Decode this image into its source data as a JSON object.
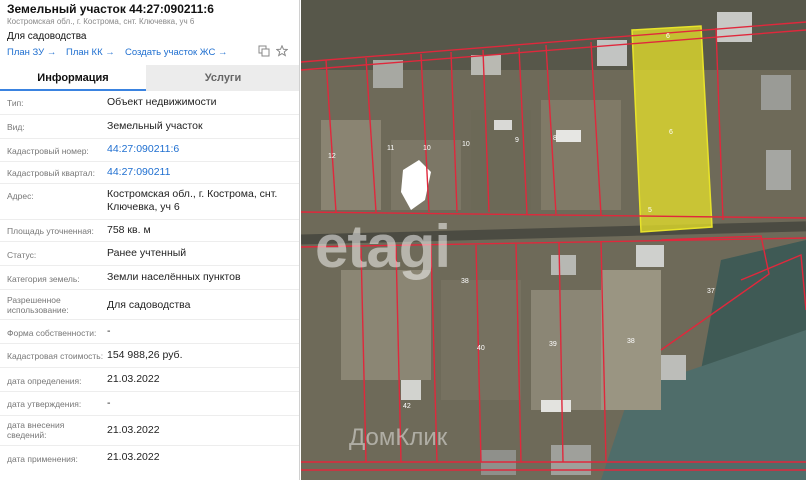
{
  "header": {
    "title": "Земельный участок 44:27:090211:6",
    "address": "Костромская обл., г. Кострома, снт. Ключевка, уч 6",
    "usage": "Для садоводства"
  },
  "links": {
    "plan_zu": "План ЗУ",
    "plan_kk": "План КК",
    "create_zhs": "Создать участок ЖС",
    "arrow": "→"
  },
  "tabs": {
    "info": "Информация",
    "services": "Услуги"
  },
  "rows": [
    {
      "label": "Тип:",
      "value": "Объект недвижимости"
    },
    {
      "label": "Вид:",
      "value": "Земельный участок"
    },
    {
      "label": "Кадастровый номер:",
      "value": "44:27:090211:6"
    },
    {
      "label": "Кадастровый квартал:",
      "value": "44:27:090211"
    },
    {
      "label": "Адрес:",
      "value": "Костромская обл., г. Кострома, снт. Ключевка, уч 6"
    },
    {
      "label": "Площадь уточненная:",
      "value": "758 кв. м"
    },
    {
      "label": "Статус:",
      "value": "Ранее учтенный"
    },
    {
      "label": "Категория земель:",
      "value": "Земли населённых пунктов"
    },
    {
      "label": "Разрешенное использование:",
      "value": "Для садоводства"
    },
    {
      "label": "Форма собственности:",
      "value": "-"
    },
    {
      "label": "Кадастровая стоимость:",
      "value": "154 988,26 руб."
    },
    {
      "label": "дата определения:",
      "value": "21.03.2022"
    },
    {
      "label": "дата утверждения:",
      "value": "-"
    },
    {
      "label": "дата внесения сведений:",
      "value": "21.03.2022"
    },
    {
      "label": "дата применения:",
      "value": "21.03.2022"
    }
  ],
  "map": {
    "watermark": "etagi",
    "watermark2": "ДомКлик",
    "parcel_numbers": [
      "6",
      "6",
      "12",
      "11",
      "10",
      "10",
      "9",
      "8",
      "37",
      "40",
      "39",
      "38",
      "38",
      "42",
      "5"
    ],
    "colors": {
      "highlight": "#e8e32a",
      "boundary": "#e0283c",
      "link": "#1f6fd0"
    }
  }
}
